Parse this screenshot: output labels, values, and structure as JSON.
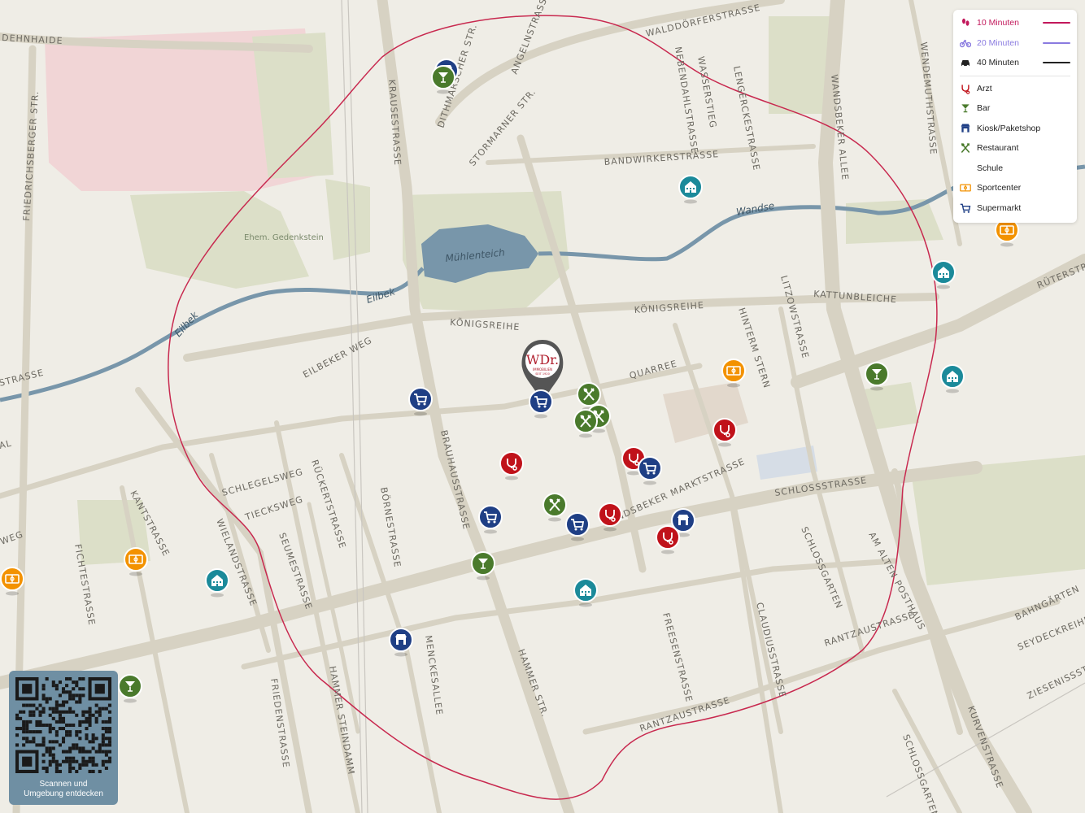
{
  "legend": {
    "isochrones": [
      {
        "label": "10 Minuten",
        "color": "#c2185b",
        "icon": "walk-icon"
      },
      {
        "label": "20 Minuten",
        "color": "#8a7be0",
        "icon": "bike-icon"
      },
      {
        "label": "40 Minuten",
        "color": "#222222",
        "icon": "car-icon"
      }
    ],
    "categories": [
      {
        "label": "Arzt",
        "color": "#c0121a",
        "icon": "doctor-icon"
      },
      {
        "label": "Bar",
        "color": "#4a7a2c",
        "icon": "bar-icon"
      },
      {
        "label": "Kiosk/Paketshop",
        "color": "#1f3f85",
        "icon": "kiosk-icon"
      },
      {
        "label": "Restaurant",
        "color": "#4a7a2c",
        "icon": "restaurant-icon"
      },
      {
        "label": "Schule",
        "color": "#1b8a9a",
        "icon": "school-icon"
      },
      {
        "label": "Sportcenter",
        "color": "#f39200",
        "icon": "sport-icon"
      },
      {
        "label": "Supermarkt",
        "color": "#1f3f85",
        "icon": "supermarket-icon"
      }
    ]
  },
  "qr": {
    "caption_line1": "Scannen und",
    "caption_line2": "Umgebung entdecken"
  },
  "logo": {
    "text": "WDr.",
    "sub1": "IMMOBILIEN",
    "sub2": "SEIT 1920",
    "color": "#b01f2e"
  },
  "streets": {
    "dehnhaide": "DEHNHAIDE",
    "friedrichsberger": "FRIEDRICHSBERGER STR.",
    "krausestrasse": "KRAUSESTRASSE",
    "dithmarscher": "DITHMARSCHER STR.",
    "angelnstrasse": "ANGELNSTRASSE",
    "stormarner": "STORMARNER STR.",
    "walddoerfer": "WALDDÖRFERSTRASSE",
    "nebendahl": "NEBENDAHLSTRASSE",
    "wasserstieg": "WASSERSTIEG",
    "lengercke": "LENGERCKESTRASSE",
    "bandwirker": "BANDWIRKERSTRASSE",
    "wandsbeker_allee": "WANDSBEKER ALLEE",
    "wendemuth": "WENDEMUTHSTRASSE",
    "koenigsreihe1": "KÖNIGSREIHE",
    "koenigsreihe2": "KÖNIGSREIHE",
    "kattunbleiche": "KATTUNBLEICHE",
    "ruetersstrasse": "RÜTERSTR.",
    "eilbeker_weg": "EILBEKER WEG",
    "quarree": "QUARREE",
    "hinterm_stern": "HINTERM STERN",
    "litzowstrasse": "LITZOWSTRASSE",
    "wandsbeker_markt": "WANDSBEKER MARKTSTRASSE",
    "schlossstrasse": "SCHLOSSSTRASSE",
    "brauhaus": "BRAUHAUSSTRASSE",
    "schlegelsweg": "SCHLEGELSWEG",
    "tieckweg": "TIECKSWEG",
    "rueckert": "RÜCKERTSTRASSE",
    "boernestrasse": "BÖRNESTRASSE",
    "kantstrasse": "KANTSTRASSE",
    "wielandstrasse": "WIELANDSTRASSE",
    "seumestrasse": "SEUMESTRASSE",
    "fichtestrasse": "FICHTESTRASSE",
    "hammer_str": "HAMMER STR.",
    "menckesallee": "MENCKESALLEE",
    "friedenstrasse": "FRIEDENSTRASSE",
    "hammer_steindamm": "HAMMER STEINDAMM",
    "freesenstrasse": "FREESENSTRASSE",
    "claudius": "CLAUDIUSSTRASSE",
    "schlossgarten1": "SCHLOSSGARTEN",
    "schlossgarten2": "SCHLOSSGARTEN",
    "am_alten_posthaus": "AM ALTEN POSTHAUS",
    "rantzau1": "RANTZAUSTRASSE",
    "rantzau2": "RANTZAUSTRASSE",
    "bahngaerten": "BAHNGÄRTEN",
    "seydeck": "SEYDECKREIHE",
    "ziesenis": "ZIESENISSSTRA",
    "kurvenstrasse": "KURVENSTRASSE",
    "eilbek_strasse": "STRASSE",
    "al": "AL",
    "weg": "WEG"
  },
  "water": {
    "muehlenteich": "Mühlenteich",
    "wandse": "Wandse",
    "eilbek1": "Eilbek",
    "eilbek2": "Eilbek"
  },
  "areas": {
    "gedenkstein": "Ehem. Gedenkstein"
  },
  "pois": [
    {
      "cat": "kiosk",
      "icon": "kiosk-icon"
    },
    {
      "cat": "bar",
      "icon": "bar-icon"
    },
    {
      "cat": "school",
      "icon": "school-icon"
    },
    {
      "cat": "sport",
      "icon": "sport-icon"
    },
    {
      "cat": "school",
      "icon": "school-icon"
    },
    {
      "cat": "bar",
      "icon": "bar-icon"
    },
    {
      "cat": "school",
      "icon": "school-icon"
    },
    {
      "cat": "sport",
      "icon": "sport-icon"
    },
    {
      "cat": "doctor",
      "icon": "doctor-icon"
    },
    {
      "cat": "supermarket",
      "icon": "supermarket-icon"
    },
    {
      "cat": "supermarket",
      "icon": "supermarket-icon"
    },
    {
      "cat": "restaurant",
      "icon": "restaurant-icon"
    },
    {
      "cat": "restaurant",
      "icon": "restaurant-icon"
    },
    {
      "cat": "restaurant",
      "icon": "restaurant-icon"
    },
    {
      "cat": "doctor",
      "icon": "doctor-icon"
    },
    {
      "cat": "doctor",
      "icon": "doctor-icon"
    },
    {
      "cat": "supermarket",
      "icon": "supermarket-icon"
    },
    {
      "cat": "supermarket",
      "icon": "supermarket-icon"
    },
    {
      "cat": "restaurant",
      "icon": "restaurant-icon"
    },
    {
      "cat": "supermarket",
      "icon": "supermarket-icon"
    },
    {
      "cat": "doctor",
      "icon": "doctor-icon"
    },
    {
      "cat": "kiosk",
      "icon": "kiosk-icon"
    },
    {
      "cat": "doctor",
      "icon": "doctor-icon"
    },
    {
      "cat": "bar",
      "icon": "bar-icon"
    },
    {
      "cat": "school",
      "icon": "school-icon"
    },
    {
      "cat": "sport",
      "icon": "sport-icon"
    },
    {
      "cat": "school",
      "icon": "school-icon"
    },
    {
      "cat": "kiosk",
      "icon": "kiosk-icon"
    },
    {
      "cat": "bar",
      "icon": "bar-icon"
    },
    {
      "cat": "sport",
      "icon": "sport-icon"
    }
  ],
  "colors": {
    "doctor": "#c0121a",
    "bar": "#4a7a2c",
    "restaurant": "#4a7a2c",
    "kiosk": "#1f3f85",
    "supermarket": "#1f3f85",
    "school": "#1b8a9a",
    "sport": "#f39200",
    "isochrone": "#c8294f",
    "water": "#7896aa",
    "park": "#dcdfc8",
    "pink": "#f1d5d6"
  }
}
